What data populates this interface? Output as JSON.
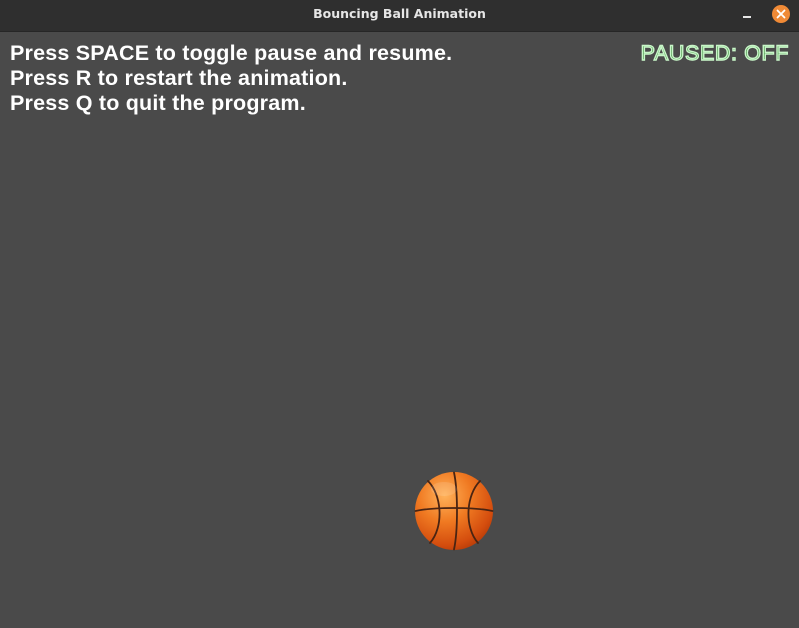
{
  "window": {
    "title": "Bouncing Ball Animation",
    "minimize_icon": "minimize-icon",
    "close_icon": "close-icon",
    "close_color": "#f08a36"
  },
  "app": {
    "background": "#4a4a4a",
    "instructions": [
      "Press SPACE to toggle pause and resume.",
      "Press R to restart the animation.",
      "Press Q to quit the program."
    ],
    "status": "PAUSED: OFF",
    "status_color": "#c8f6c8",
    "ball_icon": "basketball-icon"
  }
}
